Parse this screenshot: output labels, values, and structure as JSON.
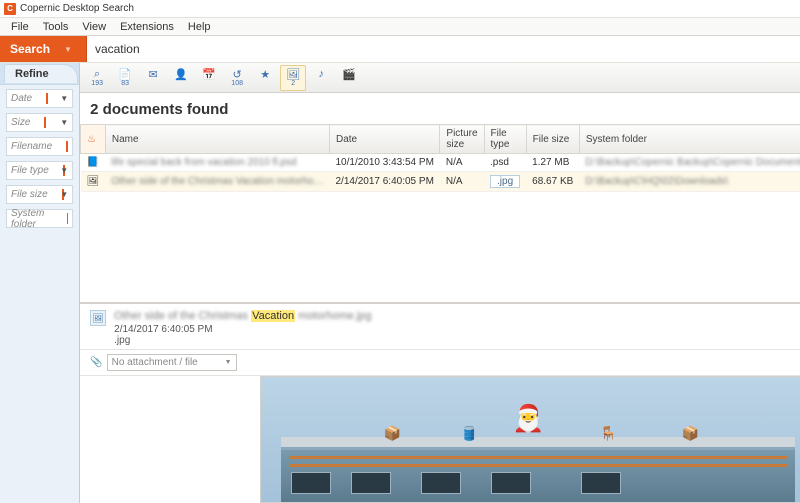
{
  "app": {
    "title": "Copernic Desktop Search",
    "icon_letter": "C"
  },
  "menu": {
    "file": "File",
    "tools": "Tools",
    "view": "View",
    "extensions": "Extensions",
    "help": "Help"
  },
  "search": {
    "button": "Search",
    "value": "vacation"
  },
  "refine": {
    "tab": "Refine",
    "fields": [
      {
        "label": "Date",
        "dropdown": true
      },
      {
        "label": "Size",
        "dropdown": true
      },
      {
        "label": "Filename",
        "dropdown": false
      },
      {
        "label": "File type",
        "dropdown": true
      },
      {
        "label": "File size",
        "dropdown": true
      },
      {
        "label": "System folder",
        "dropdown": false
      }
    ]
  },
  "categories": [
    {
      "name": "all",
      "icon": "⌕",
      "count": "193"
    },
    {
      "name": "files",
      "icon": "📄",
      "count": "83"
    },
    {
      "name": "emails",
      "icon": "✉",
      "count": ""
    },
    {
      "name": "contacts",
      "icon": "👤",
      "count": ""
    },
    {
      "name": "calendar",
      "icon": "📅",
      "count": ""
    },
    {
      "name": "history",
      "icon": "↺",
      "count": "108"
    },
    {
      "name": "favorites",
      "icon": "★",
      "count": ""
    },
    {
      "name": "pictures",
      "icon": "🖼",
      "count": "2",
      "active": true
    },
    {
      "name": "music",
      "icon": "♪",
      "count": ""
    },
    {
      "name": "videos",
      "icon": "🎬",
      "count": ""
    }
  ],
  "results": {
    "heading": "2 documents found",
    "columns": {
      "name": "Name",
      "date": "Date",
      "picsize": "Picture size",
      "ftype": "File type",
      "fsize": "File size",
      "folder": "System folder"
    },
    "rows": [
      {
        "name": "life special back from vacation 2010 fl.psd",
        "date": "10/1/2010 3:43:54 PM",
        "picsize": "N/A",
        "ftype": ".psd",
        "fsize": "1.27 MB",
        "folder": "D:\\Backup\\Copernic Backup\\Copernic Documents\\"
      },
      {
        "name": "Other side of the Christmas Vacation motorho…",
        "date": "2/14/2017 6:40:05 PM",
        "picsize": "N/A",
        "ftype": ".jpg",
        "fsize": "68.67 KB",
        "folder": "D:\\Backup\\C\\HQ\\02\\Downloads\\",
        "selected": true
      }
    ]
  },
  "preview": {
    "title_pre": "Other side of the Christmas ",
    "title_hl": "Vacation",
    "title_post": " motorhome.jpg",
    "date": "2/14/2017 6:40:05 PM",
    "ext": ".jpg",
    "attachment_label": "No attachment / file"
  }
}
